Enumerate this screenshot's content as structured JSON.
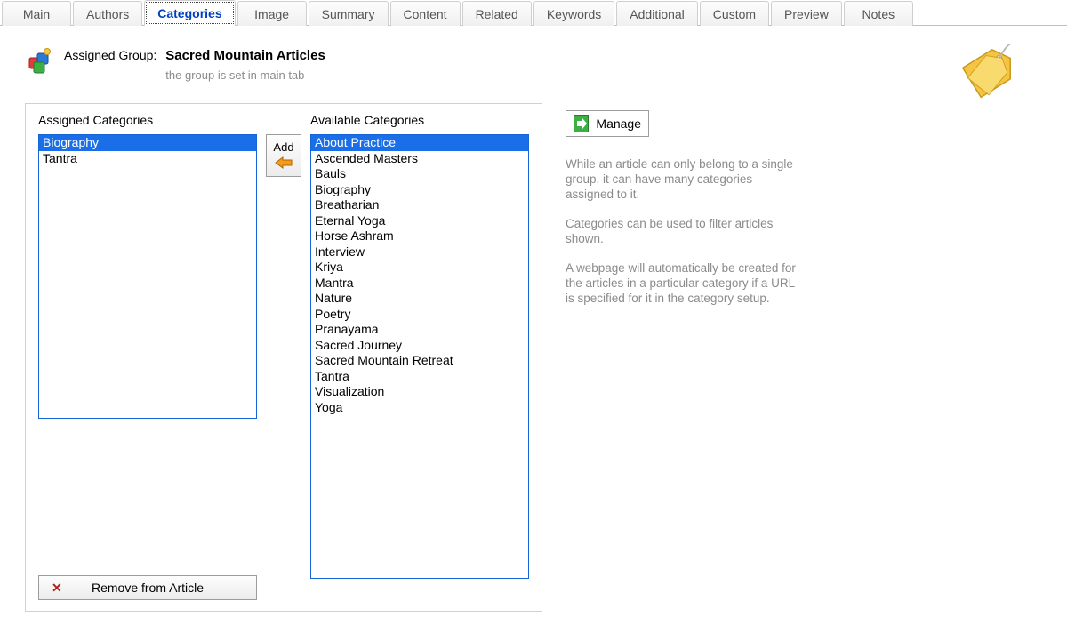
{
  "tabs": [
    {
      "label": "Main",
      "active": false
    },
    {
      "label": "Authors",
      "active": false
    },
    {
      "label": "Categories",
      "active": true
    },
    {
      "label": "Image",
      "active": false
    },
    {
      "label": "Summary",
      "active": false
    },
    {
      "label": "Content",
      "active": false
    },
    {
      "label": "Related",
      "active": false
    },
    {
      "label": "Keywords",
      "active": false
    },
    {
      "label": "Additional",
      "active": false
    },
    {
      "label": "Custom",
      "active": false
    },
    {
      "label": "Preview",
      "active": false
    },
    {
      "label": "Notes",
      "active": false
    }
  ],
  "group": {
    "label": "Assigned Group:",
    "name": "Sacred Mountain Articles",
    "hint": "the group is set in main tab"
  },
  "assigned": {
    "title": "Assigned Categories",
    "items": [
      {
        "label": "Biography",
        "selected": true
      },
      {
        "label": "Tantra",
        "selected": false
      }
    ]
  },
  "available": {
    "title": "Available Categories",
    "items": [
      {
        "label": "About Practice",
        "selected": true
      },
      {
        "label": "Ascended Masters",
        "selected": false
      },
      {
        "label": "Bauls",
        "selected": false
      },
      {
        "label": "Biography",
        "selected": false
      },
      {
        "label": "Breatharian",
        "selected": false
      },
      {
        "label": "Eternal Yoga",
        "selected": false
      },
      {
        "label": "Horse Ashram",
        "selected": false
      },
      {
        "label": "Interview",
        "selected": false
      },
      {
        "label": "Kriya",
        "selected": false
      },
      {
        "label": "Mantra",
        "selected": false
      },
      {
        "label": "Nature",
        "selected": false
      },
      {
        "label": "Poetry",
        "selected": false
      },
      {
        "label": "Pranayama",
        "selected": false
      },
      {
        "label": "Sacred Journey",
        "selected": false
      },
      {
        "label": "Sacred Mountain Retreat",
        "selected": false
      },
      {
        "label": "Tantra",
        "selected": false
      },
      {
        "label": "Visualization",
        "selected": false
      },
      {
        "label": "Yoga",
        "selected": false
      }
    ]
  },
  "buttons": {
    "add": "Add",
    "remove": "Remove from Article",
    "manage": "Manage"
  },
  "info": {
    "p1": "While an article can only belong to a single group, it can have many categories assigned to it.",
    "p2": "Categories can be used to filter articles shown.",
    "p3": "A webpage will automatically be created for the articles in a particular category if a URL is specified for it in the category setup."
  }
}
